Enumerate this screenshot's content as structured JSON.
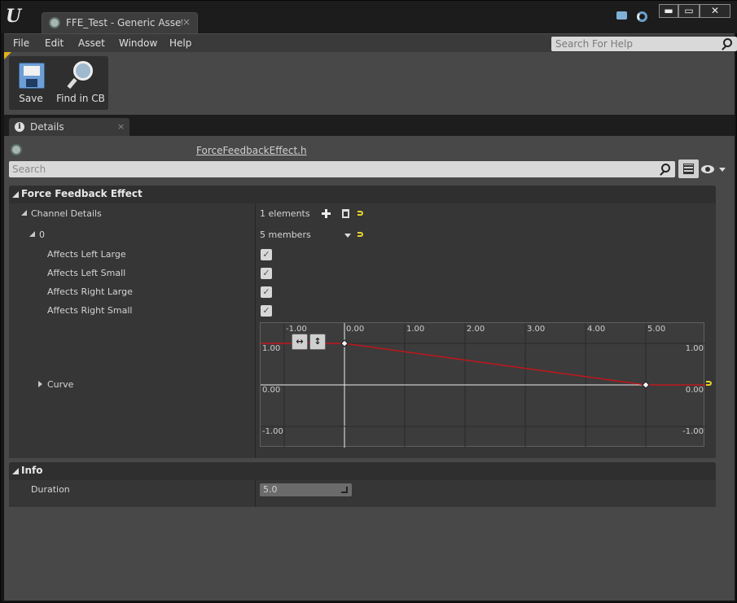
{
  "window": {
    "tab_title": "FFE_Test - Generic Asset E",
    "tab_close": "×",
    "buttons": {
      "minimize": "▬",
      "maximize": "▭",
      "close": "✕"
    }
  },
  "menu": {
    "items": [
      "File",
      "Edit",
      "Asset",
      "Window",
      "Help"
    ],
    "help_search_placeholder": "Search For Help"
  },
  "toolbar": {
    "save_label": "Save",
    "find_label": "Find in CB"
  },
  "details_tab": {
    "label": "Details",
    "close": "×",
    "info_glyph": "i"
  },
  "details": {
    "header_file": "ForceFeedbackEffect.h",
    "search_placeholder": "Search"
  },
  "force_feedback": {
    "category": "Force Feedback Effect",
    "channel_details_label": "Channel Details",
    "channel_details_value": "1 elements",
    "element_index": "0",
    "element_value": "5 members",
    "properties": [
      {
        "label": "Affects Left Large",
        "checked": true
      },
      {
        "label": "Affects Left Small",
        "checked": true
      },
      {
        "label": "Affects Right Large",
        "checked": true
      },
      {
        "label": "Affects Right Small",
        "checked": true
      }
    ],
    "checkmark": "✓",
    "curve_label": "Curve"
  },
  "curve": {
    "x_ticks": [
      "-1.00",
      "0.00",
      "1.00",
      "2.00",
      "3.00",
      "4.00",
      "5.00"
    ],
    "y_left": [
      "1.00",
      "0.00",
      "-1.00"
    ],
    "y_right": [
      "1.00",
      "0.00",
      "-1.00"
    ],
    "keys": [
      {
        "t": 0.0,
        "v": 1.0
      },
      {
        "t": 5.0,
        "v": 0.0
      }
    ],
    "zoom_fit_h_icon": "↔",
    "zoom_fit_v_icon": "↕",
    "curve_color": "#c0161c"
  },
  "info": {
    "category": "Info",
    "duration_label": "Duration",
    "duration_value": "5.0"
  }
}
